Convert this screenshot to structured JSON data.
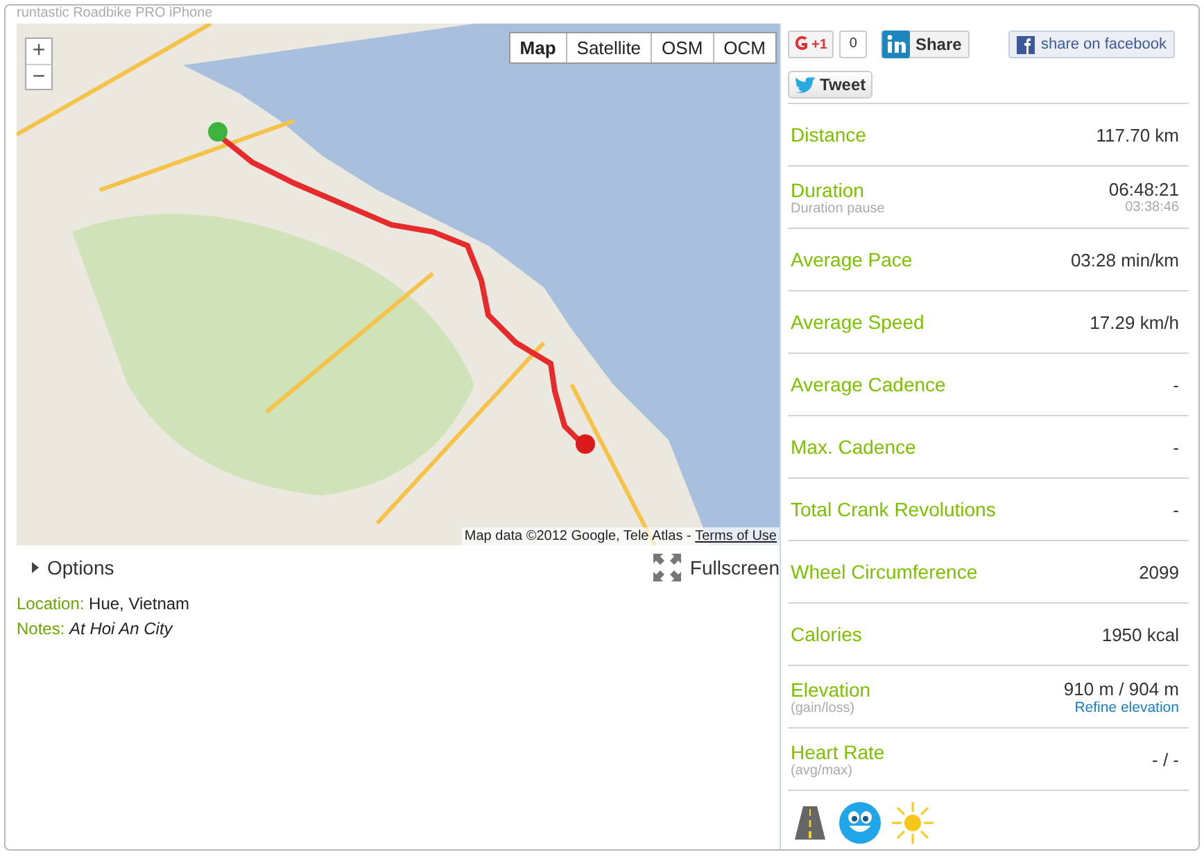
{
  "app_title": "runtastic Roadbike PRO iPhone",
  "map": {
    "zoom_in": "+",
    "zoom_out": "−",
    "map_types": [
      {
        "label": "Map",
        "selected": true
      },
      {
        "label": "Satellite",
        "selected": false
      },
      {
        "label": "OSM",
        "selected": false
      },
      {
        "label": "OCM",
        "selected": false
      }
    ],
    "attribution": "Map data ©2012 Google, Tele Atlas - ",
    "terms_link": "Terms of Use"
  },
  "options": {
    "label": "Options",
    "expanded": false
  },
  "fullscreen": "Fullscreen",
  "details": [
    {
      "label": "Location:",
      "value": "Hue, Vietnam",
      "italic": false
    },
    {
      "label": "Notes:",
      "value": "At Hoi An City",
      "italic": true
    }
  ],
  "social": {
    "plus_one": "+1",
    "plus_count": "0",
    "linkedin": "Share",
    "facebook": "share on facebook",
    "tweet": "Tweet"
  },
  "stats": [
    {
      "label": "Distance",
      "value": "117.70 km"
    },
    {
      "label": "Duration",
      "sublabel": "Duration pause",
      "value": "06:48:21",
      "subvalue": "03:38:46"
    },
    {
      "label": "Average Pace",
      "value": "03:28 min/km"
    },
    {
      "label": "Average Speed",
      "value": "17.29 km/h"
    },
    {
      "label": "Average Cadence",
      "value": "-"
    },
    {
      "label": "Max. Cadence",
      "value": "-"
    },
    {
      "label": "Total Crank Revolutions",
      "value": "-"
    },
    {
      "label": "Wheel Circumference",
      "value": "2099"
    },
    {
      "label": "Calories",
      "value": "1950 kcal"
    },
    {
      "label": "Elevation",
      "sublabel": "(gain/loss)",
      "value": "910 m / 904 m",
      "link": "Refine elevation"
    },
    {
      "label": "Heart Rate",
      "sublabel": "(avg/max)",
      "value": "- / -"
    }
  ]
}
